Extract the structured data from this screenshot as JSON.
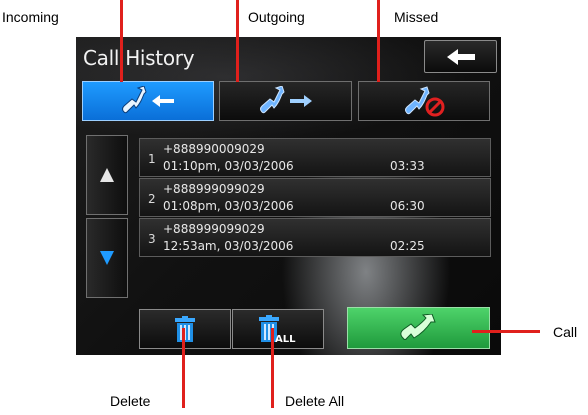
{
  "callouts": {
    "incoming": "Incoming",
    "outgoing": "Outgoing",
    "missed": "Missed",
    "call": "Call",
    "delete": "Delete",
    "delete_all": "Delete All"
  },
  "window": {
    "title": "Call History",
    "back_icon": "arrow-left-icon"
  },
  "tabs": [
    {
      "id": "incoming",
      "icon": "phone-incoming-icon",
      "active": true
    },
    {
      "id": "outgoing",
      "icon": "phone-outgoing-icon",
      "active": false
    },
    {
      "id": "missed",
      "icon": "phone-missed-icon",
      "active": false
    }
  ],
  "calls": [
    {
      "index": "1",
      "number": "+888990009029",
      "datetime": "01:10pm, 03/03/2006",
      "duration": "03:33"
    },
    {
      "index": "2",
      "number": "+888999099029",
      "datetime": "01:08pm, 03/03/2006",
      "duration": "06:30"
    },
    {
      "index": "3",
      "number": "+888999099029",
      "datetime": "12:53am, 03/03/2006",
      "duration": "02:25"
    }
  ],
  "toolbar": {
    "delete_all_badge": "ALL"
  },
  "colors": {
    "accent_blue": "#1f9bff",
    "call_green": "#3cc35a",
    "callout_red": "#e0201c"
  }
}
